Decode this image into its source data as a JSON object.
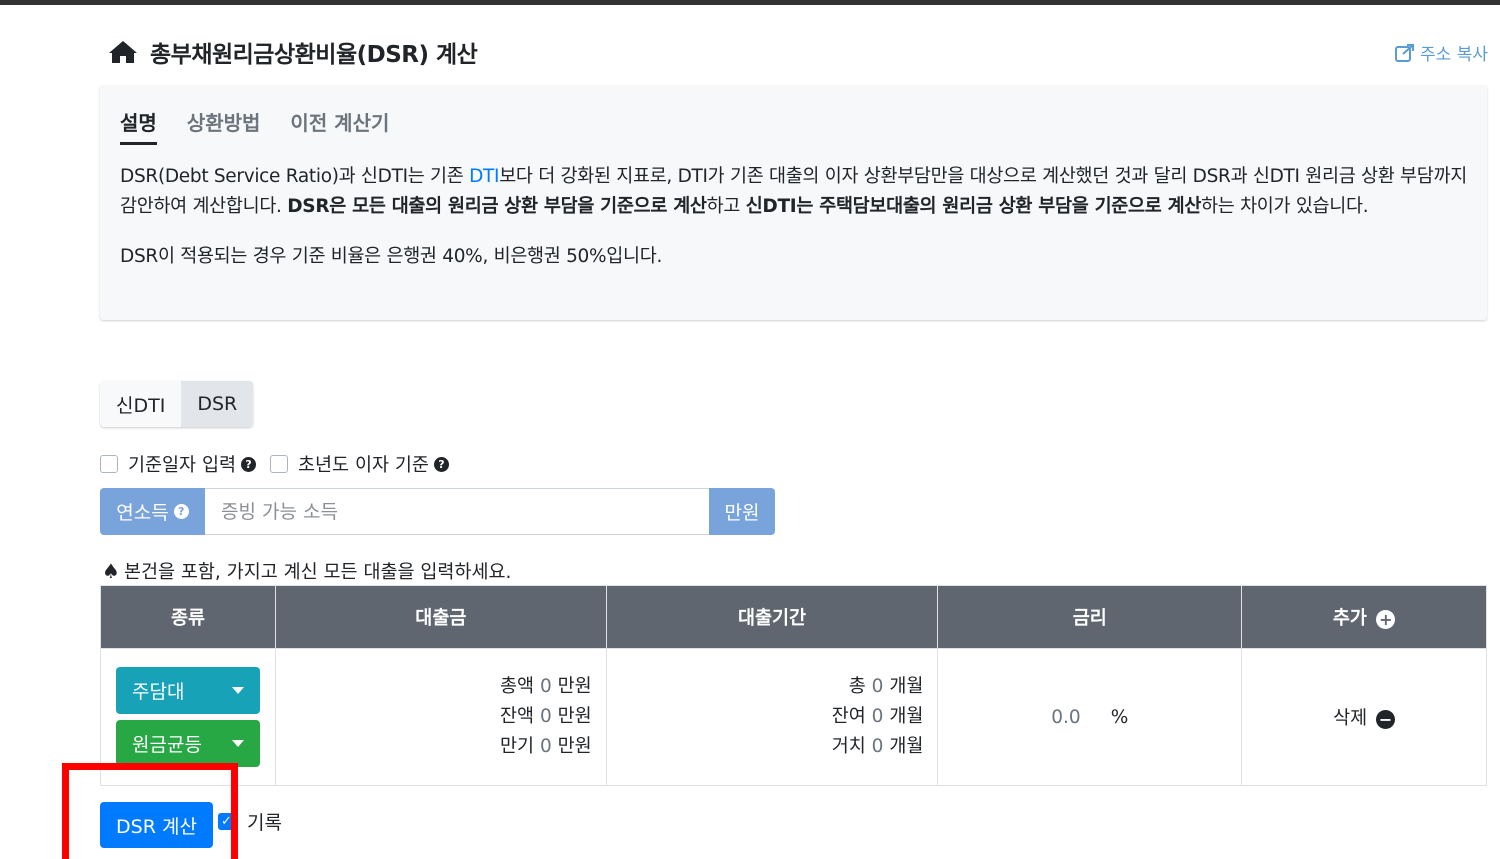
{
  "page": {
    "title": "총부채원리금상환비율(DSR) 계산",
    "share_label": "주소 복사"
  },
  "tabs": [
    "설명",
    "상환방법",
    "이전 계산기"
  ],
  "description": {
    "p1_a": "DSR(Debt Service Ratio)과 신DTI는 기존 ",
    "p1_link": "DTI",
    "p1_b": "보다 더 강화된 지표로, DTI가 기존 대출의 이자 상환부담만을 대상으로 계산했던 것과 달리 DSR과 신DTI 원리금 상환 부담까지 감안하여 계산합니다. ",
    "p1_bold1": "DSR은 모든 대출의 원리금 상환 부담을 기준으로 계산",
    "p1_c": "하고 ",
    "p1_bold2": "신DTI는 주택담보대출의 원리금 상환 부담을 기준으로 계산",
    "p1_d": "하는 차이가 있습니다.",
    "p2": "DSR이 적용되는 경우 기준 비율은 은행권 40%, 비은행권 50%입니다."
  },
  "mode_toggle": [
    "신DTI",
    "DSR"
  ],
  "options": {
    "base_date": "기준일자 입력",
    "first_year_interest": "초년도 이자 기준"
  },
  "income": {
    "label": "연소득",
    "placeholder": "증빙 가능 소득",
    "unit": "만원"
  },
  "note": "본건을 포함, 가지고 계신 모든 대출을 입력하세요.",
  "table": {
    "headers": [
      "종류",
      "대출금",
      "대출기간",
      "금리",
      "추가"
    ],
    "row": {
      "type": "주담대",
      "method": "원금균등",
      "amount": [
        {
          "label": "총액",
          "value": "0",
          "unit": "만원"
        },
        {
          "label": "잔액",
          "value": "0",
          "unit": "만원"
        },
        {
          "label": "만기",
          "value": "0",
          "unit": "만원"
        }
      ],
      "period": [
        {
          "label": "총",
          "value": "0",
          "unit": "개월"
        },
        {
          "label": "잔여",
          "value": "0",
          "unit": "개월"
        },
        {
          "label": "거치",
          "value": "0",
          "unit": "개월"
        }
      ],
      "rate": {
        "value": "0.0",
        "unit": "%"
      },
      "delete_label": "삭제"
    }
  },
  "calc_button": "DSR 계산",
  "record_label": "기록"
}
